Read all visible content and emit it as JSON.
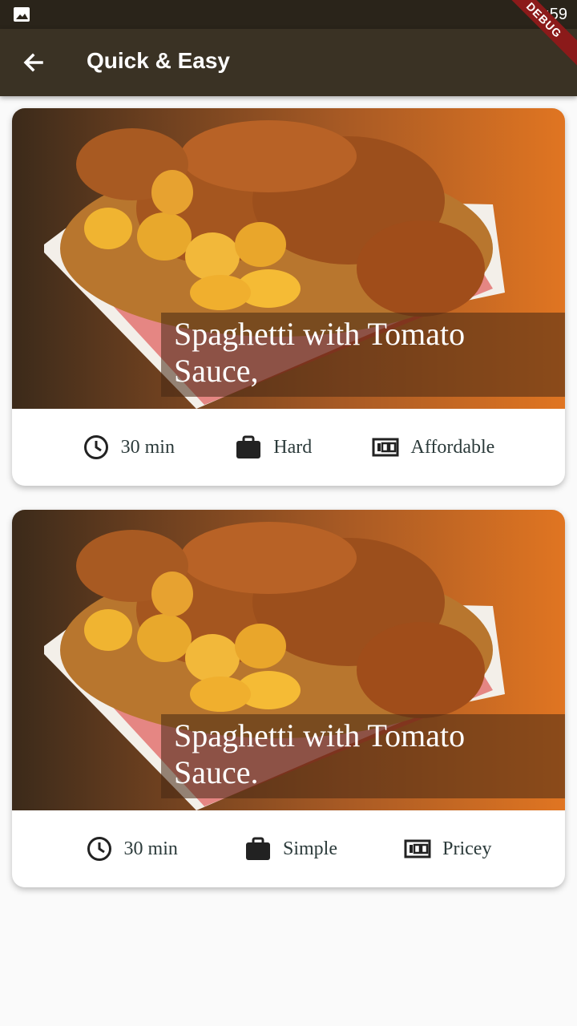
{
  "status_bar": {
    "time": "8:59"
  },
  "app_bar": {
    "title": "Quick & Easy",
    "debug_label": "DEBUG"
  },
  "meals": [
    {
      "title": "Spaghetti with Tomato Sauce,",
      "duration": "30 min",
      "complexity": "Hard",
      "affordability": "Affordable"
    },
    {
      "title": "Spaghetti with Tomato Sauce.",
      "duration": "30 min",
      "complexity": "Simple",
      "affordability": "Pricey"
    }
  ],
  "colors": {
    "app_bar": "#3a3224",
    "status_bar": "#2a241a",
    "accent": "#e07522"
  }
}
